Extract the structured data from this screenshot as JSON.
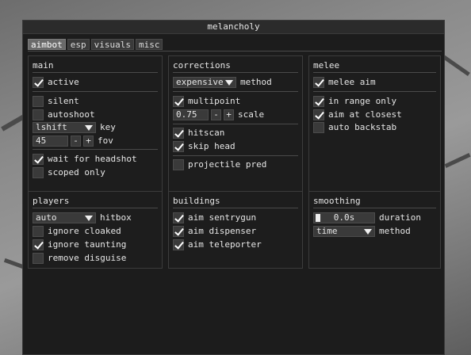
{
  "window": {
    "title": "melancholy"
  },
  "tabs": [
    "aimbot",
    "esp",
    "visuals",
    "misc"
  ],
  "main": {
    "title": "main",
    "active": {
      "label": "active",
      "checked": true
    },
    "silent": {
      "label": "silent",
      "checked": false
    },
    "autoshoot": {
      "label": "autoshoot",
      "checked": false
    },
    "key": {
      "value": "lshift",
      "label": "key"
    },
    "fov": {
      "value": "45",
      "minus": "-",
      "plus": "+",
      "label": "fov"
    },
    "wait_for_headshot": {
      "label": "wait for headshot",
      "checked": true
    },
    "scoped_only": {
      "label": "scoped only",
      "checked": false
    }
  },
  "corrections": {
    "title": "corrections",
    "method": {
      "value": "expensive",
      "label": "method"
    },
    "multipoint": {
      "label": "multipoint",
      "checked": true
    },
    "scale": {
      "value": "0.75",
      "minus": "-",
      "plus": "+",
      "label": "scale"
    },
    "hitscan": {
      "label": "hitscan",
      "checked": true
    },
    "skip_head": {
      "label": "skip head",
      "checked": true
    },
    "projectile_pred": {
      "label": "projectile pred",
      "checked": false
    }
  },
  "melee": {
    "title": "melee",
    "melee_aim": {
      "label": "melee aim",
      "checked": true
    },
    "in_range_only": {
      "label": "in range only",
      "checked": true
    },
    "aim_at_closest": {
      "label": "aim at closest",
      "checked": true
    },
    "auto_backstab": {
      "label": "auto backstab",
      "checked": false
    }
  },
  "players": {
    "title": "players",
    "hitbox": {
      "value": "auto",
      "label": "hitbox"
    },
    "ignore_cloaked": {
      "label": "ignore cloaked",
      "checked": false
    },
    "ignore_taunting": {
      "label": "ignore taunting",
      "checked": true
    },
    "remove_disguise": {
      "label": "remove disguise",
      "checked": false
    }
  },
  "buildings": {
    "title": "buildings",
    "aim_sentrygun": {
      "label": "aim sentrygun",
      "checked": true
    },
    "aim_dispenser": {
      "label": "aim dispenser",
      "checked": true
    },
    "aim_teleporter": {
      "label": "aim teleporter",
      "checked": true
    }
  },
  "smoothing": {
    "title": "smoothing",
    "duration": {
      "value": "0.0s",
      "fraction": 0,
      "label": "duration"
    },
    "method": {
      "value": "time",
      "label": "method"
    }
  }
}
